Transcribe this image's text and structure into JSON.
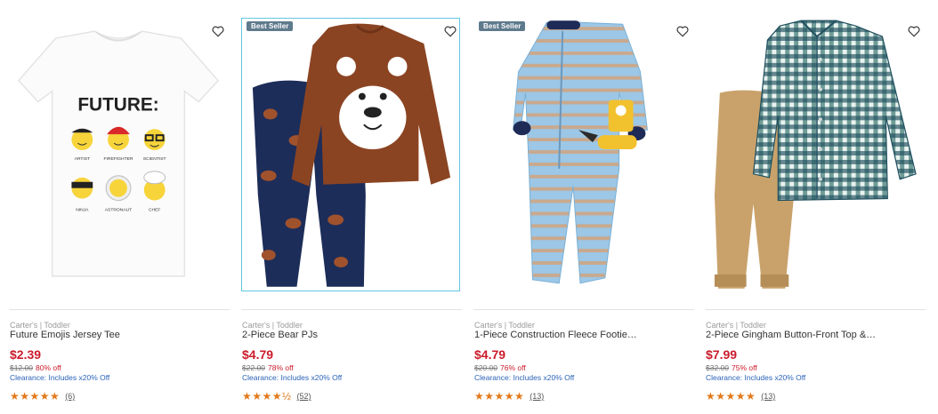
{
  "products": [
    {
      "badge": "",
      "brand": "Carter's | Toddler",
      "title": "Future Emojis Jersey Tee",
      "price": "$2.39",
      "original_price": "$12.00",
      "discount": "80% off",
      "clearance": "Clearance: Includes x20% Off",
      "stars": "★★★★★",
      "rating": 5,
      "review_count": "(6)",
      "tee_text": "FUTURE:",
      "emoji_labels": [
        "ARTIST",
        "FIREFIGHTER",
        "SCIENTIST",
        "NINJA",
        "ASTRONAUT",
        "CHEF"
      ]
    },
    {
      "badge": "Best Seller",
      "brand": "Carter's | Toddler",
      "title": "2-Piece Bear PJs",
      "price": "$4.79",
      "original_price": "$22.00",
      "discount": "78% off",
      "clearance": "Clearance: Includes x20% Off",
      "stars": "★★★★½",
      "rating": 4.5,
      "review_count": "(52)"
    },
    {
      "badge": "Best Seller",
      "brand": "Carter's | Toddler",
      "title": "1-Piece Construction Fleece Footie…",
      "price": "$4.79",
      "original_price": "$20.00",
      "discount": "76% off",
      "clearance": "Clearance: Includes x20% Off",
      "stars": "★★★★★",
      "rating": 5,
      "review_count": "(13)"
    },
    {
      "badge": "",
      "brand": "Carter's | Toddler",
      "title": "2-Piece Gingham Button-Front Top &…",
      "price": "$7.99",
      "original_price": "$32.00",
      "discount": "75% off",
      "clearance": "Clearance: Includes x20% Off",
      "stars": "★★★★★",
      "rating": 5,
      "review_count": "(13)"
    }
  ],
  "colors": {
    "price_red": "#cc1b2b",
    "star_orange": "#e2791b",
    "link_blue": "#2b63b8",
    "badge_bg": "#5f7a8d",
    "focus_border": "#62c7e0"
  },
  "icons": {
    "wishlist": "heart-outline-icon",
    "star": "star-icon"
  }
}
